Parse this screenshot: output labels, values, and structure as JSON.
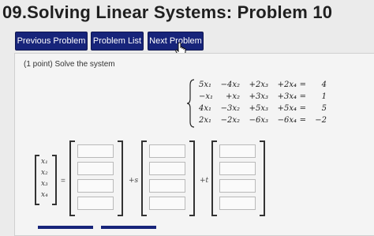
{
  "page": {
    "title": "09.Solving Linear Systems: Problem 10"
  },
  "nav": {
    "previous_label": "Previous Problem",
    "list_label": "Problem List",
    "next_label": "Next Problem"
  },
  "problem": {
    "points_prompt": "(1 point) Solve the system",
    "equations": [
      [
        "5x₁",
        "−4x₂",
        "+2x₃",
        "+2x₄",
        "=",
        "4"
      ],
      [
        "−x₁",
        "+x₂",
        "+3x₃",
        "+3x₄",
        "=",
        "1"
      ],
      [
        "4x₁",
        "−3x₂",
        "+5x₃",
        "+5x₄",
        "=",
        "5"
      ],
      [
        "2x₁",
        "−2x₂",
        "−6x₃",
        "−6x₄",
        "=",
        "−2"
      ]
    ],
    "variables": [
      "x₁",
      "x₂",
      "x₃",
      "x₄"
    ],
    "equals_sign": "=",
    "coef_s": "+s",
    "coef_t": "+t",
    "answer_vectors": [
      [
        "",
        "",
        "",
        ""
      ],
      [
        "",
        "",
        "",
        ""
      ],
      [
        "",
        "",
        "",
        ""
      ]
    ]
  }
}
